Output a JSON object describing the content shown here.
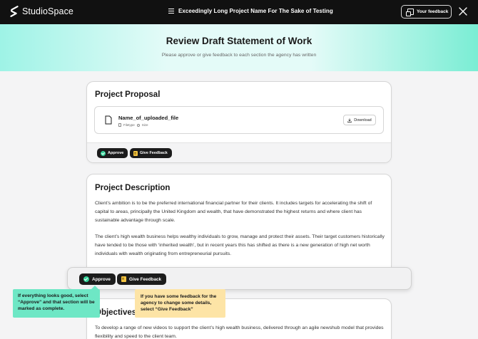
{
  "header": {
    "brand": "StudioSpace",
    "project_name": "Exceedingly Long Project Name For The Sake of Testing",
    "feedback_label": "Your feedback"
  },
  "hero": {
    "title": "Review Draft Statement of Work",
    "subtitle": "Please approve or give feedback to each section the agency has written"
  },
  "proposal": {
    "title": "Project Proposal",
    "file": {
      "name": "Name_of_uploaded_file",
      "filetype": "Filetype",
      "size": "Size",
      "download_label": "Download"
    },
    "approve_label": "Approve",
    "feedback_label": "Give Feedback"
  },
  "description": {
    "title": "Project Description",
    "paragraph_1": "Client’s ambition is to be the preferred international financial partner for their clients. It includes targets for accelerating the shift of capital to areas, principally the United Kingdom and wealth, that have demonstrated the highest returns and where client has sustainable advantage through scale.",
    "paragraph_2": "The client’s high wealth business helps wealthy individuals to grow, manage and protect their assets. Their target customers historically have tended to be those with ‘inherited wealth’, but in recent years this has shifted as there is a new generation of high net worth individuals with wealth originating from entrepreneurial pursuits."
  },
  "floatbar": {
    "approve_label": "Approve",
    "feedback_label": "Give Feedback"
  },
  "objectives": {
    "title": "Objectives",
    "paragraph": "To develop a range of new videos to support the client’s high wealth business, delivered through an agile newshub model that provides flexibility and speed to the client team."
  },
  "tooltips": {
    "approve": "If everything looks good, select “Approve” and that section will be marked as complete.",
    "feedback": "If you have some feedback for the agency to change some details, select “Give Feedback”"
  },
  "colors": {
    "header_bg": "#111111",
    "accent_green": "#6ee7c5",
    "tooltip_yellow": "#fde4a6",
    "approve_check": "#34d399",
    "feedback_note": "#f5c542"
  }
}
